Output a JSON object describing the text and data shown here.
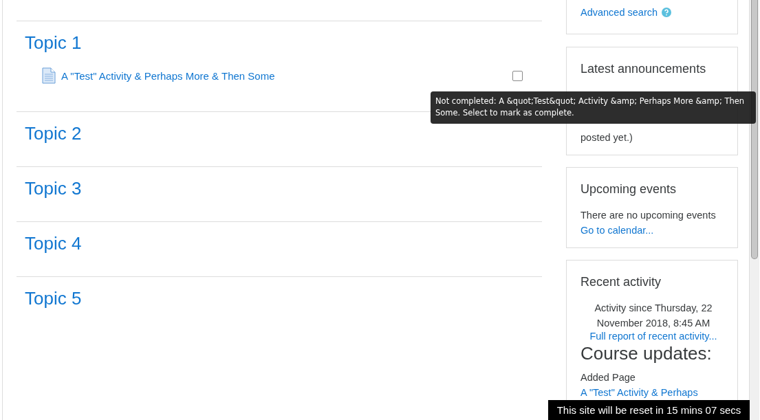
{
  "course": {
    "sections": [
      {
        "title": "Topic 1",
        "activities": [
          {
            "name": "A \"Test\" Activity & Perhaps More & Then Some",
            "completed": false
          }
        ]
      },
      {
        "title": "Topic 2"
      },
      {
        "title": "Topic 3"
      },
      {
        "title": "Topic 4"
      },
      {
        "title": "Topic 5"
      }
    ]
  },
  "tooltip": {
    "text": "Not completed: A &quot;Test&quot; Activity &amp; Perhaps More &amp; Then Some. Select to mark as complete."
  },
  "sidebar": {
    "blocks": [
      {
        "kind": "search",
        "link": "Advanced search"
      },
      {
        "kind": "news",
        "title": "Latest announcements",
        "message": "posted yet.)"
      },
      {
        "kind": "events",
        "title": "Upcoming events",
        "message": "There are no upcoming events",
        "link": "Go to calendar..."
      },
      {
        "kind": "recent",
        "title": "Recent activity",
        "since": "Activity since Thursday, 22 November 2018, 8:45 AM",
        "link": "Full report of recent activity...",
        "heading": "Course updates:",
        "update": "Added Page",
        "update_link": "A \"Test\" Activity & Perhaps"
      }
    ]
  },
  "reset_notice": "This site will be reset in 15 mins 07 secs"
}
